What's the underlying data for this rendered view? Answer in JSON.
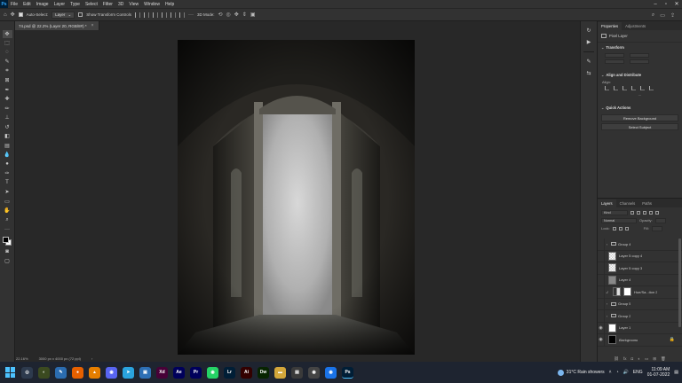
{
  "app": {
    "logo": "Ps",
    "menu": [
      "File",
      "Edit",
      "Image",
      "Layer",
      "Type",
      "Select",
      "Filter",
      "3D",
      "View",
      "Window",
      "Help"
    ]
  },
  "options_bar": {
    "auto_select_label": "Auto-Select:",
    "auto_select_value": "Layer",
    "transform_label": "Show Transform Controls",
    "mode_label": "3D Mode:"
  },
  "document": {
    "tab_title": "74.psd @ 22.2% (Layer 20, RGB/8#) *",
    "zoom": "22.16%",
    "dimensions": "3000 px x 4000 px (72 ppi)"
  },
  "properties": {
    "tabs": [
      "Properties",
      "Adjustments"
    ],
    "layer_type": "Pixel Layer",
    "transform_head": "Transform",
    "align_head": "Align and Distribute",
    "align_label": "Align:",
    "quick_head": "Quick Actions",
    "remove_bg": "Remove Background",
    "select_subject": "Select Subject"
  },
  "layers": {
    "tabs": [
      "Layers",
      "Channels",
      "Paths"
    ],
    "kind_label": "Kind",
    "normal_label": "Normal",
    "opacity_label": "Opacity:",
    "lock_label": "Lock:",
    "fill_label": "Fill:",
    "items": [
      {
        "name": "Group 4",
        "type": "group",
        "visible": false
      },
      {
        "name": "Layer 5 copy 4",
        "type": "trans",
        "visible": false
      },
      {
        "name": "Layer 5 copy 3",
        "type": "trans",
        "visible": false
      },
      {
        "name": "Layer 4",
        "type": "gray",
        "visible": false
      },
      {
        "name": "Hue/Sa...tion 2",
        "type": "adjust",
        "visible": false
      },
      {
        "name": "Group 5",
        "type": "group",
        "visible": false
      },
      {
        "name": "Group 2",
        "type": "group",
        "visible": false
      },
      {
        "name": "Layer 1",
        "type": "white",
        "visible": true
      },
      {
        "name": "Background",
        "type": "black",
        "visible": true
      }
    ]
  },
  "taskbar": {
    "weather": "31°C  Rain showers",
    "language": "ENG",
    "time": "11:09 AM",
    "date": "01-07-2022",
    "apps": [
      {
        "label": "◎",
        "color": "#2d3a4d"
      },
      {
        "label": "◐",
        "color": "#3b4a20"
      },
      {
        "label": "✎",
        "color": "#2b6cb0"
      },
      {
        "label": "●",
        "color": "#e66000"
      },
      {
        "label": "▲",
        "color": "#e67e00"
      },
      {
        "label": "◉",
        "color": "#5865f2"
      },
      {
        "label": "➤",
        "color": "#2aa3df"
      },
      {
        "label": "▣",
        "color": "#2d6fb5"
      },
      {
        "label": "Xd",
        "color": "#470137"
      },
      {
        "label": "Ae",
        "color": "#00005b"
      },
      {
        "label": "Pr",
        "color": "#00005b"
      },
      {
        "label": "◉",
        "color": "#25d366"
      },
      {
        "label": "Lr",
        "color": "#001e36"
      },
      {
        "label": "Ai",
        "color": "#330000"
      },
      {
        "label": "Dw",
        "color": "#072401"
      },
      {
        "label": "▬",
        "color": "#d3a63a"
      },
      {
        "label": "▤",
        "color": "#3a3a3a"
      },
      {
        "label": "◉",
        "color": "#444"
      },
      {
        "label": "◉",
        "color": "#1a73e8"
      },
      {
        "label": "Ps",
        "color": "#001e36"
      }
    ]
  }
}
